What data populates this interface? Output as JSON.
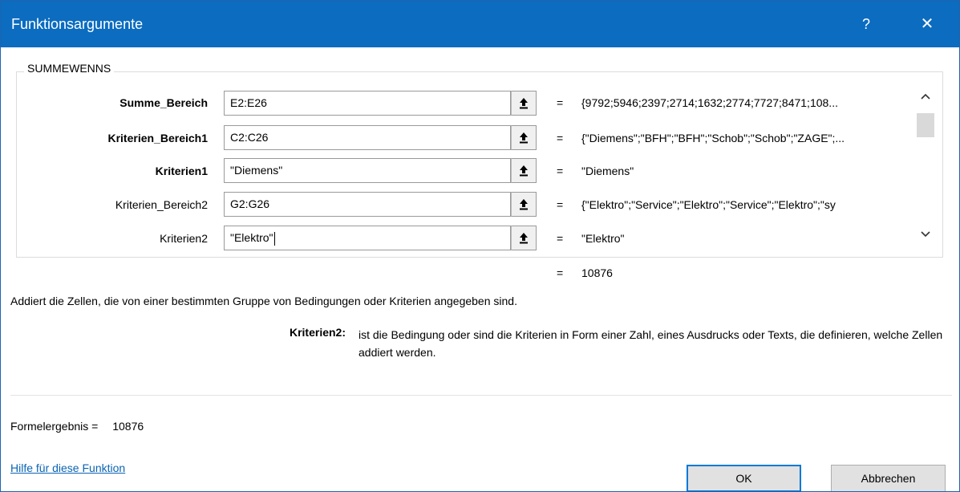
{
  "window": {
    "title": "Funktionsargumente",
    "help_glyph": "?",
    "close_glyph": "✕"
  },
  "function_name": "SUMMEWENNS",
  "arguments": [
    {
      "label": "Summe_Bereich",
      "value": "E2:E26",
      "result": "{9792;5946;2397;2714;1632;2774;7727;8471;108...",
      "required": true
    },
    {
      "label": "Kriterien_Bereich1",
      "value": "C2:C26",
      "result": "{\"Diemens\";\"BFH\";\"BFH\";\"Schob\";\"Schob\";\"ZAGE\";...",
      "required": true
    },
    {
      "label": "Kriterien1",
      "value": "\"Diemens\"",
      "result": "\"Diemens\"",
      "required": true
    },
    {
      "label": "Kriterien_Bereich2",
      "value": "G2:G26",
      "result": "{\"Elektro\";\"Service\";\"Elektro\";\"Service\";\"Elektro\";\"sy",
      "required": false
    },
    {
      "label": "Kriterien2",
      "value": "\"Elektro\"",
      "result": "\"Elektro\"",
      "required": false
    }
  ],
  "equals_sign": "=",
  "function_result": "10876",
  "description": "Addiert die Zellen, die von einer bestimmten Gruppe von Bedingungen oder Kriterien angegeben sind.",
  "active_param": {
    "name": "Kriterien2:",
    "description": "ist die Bedingung oder sind die Kriterien in Form einer Zahl, eines Ausdrucks oder Texts, die definieren, welche Zellen addiert werden."
  },
  "formula_result": {
    "label": "Formelergebnis =",
    "value": "10876"
  },
  "help_link": "Hilfe für diese Funktion",
  "buttons": {
    "ok": "OK",
    "cancel": "Abbrechen"
  },
  "colors": {
    "titlebar": "#0b6cc0",
    "link": "#0a64b4",
    "ok_border": "#0078d7"
  },
  "icons": {
    "ref_button": "collapse-dialog-arrow-up-icon",
    "scroll_up": "chevron-up-icon",
    "scroll_down": "chevron-down-icon"
  }
}
